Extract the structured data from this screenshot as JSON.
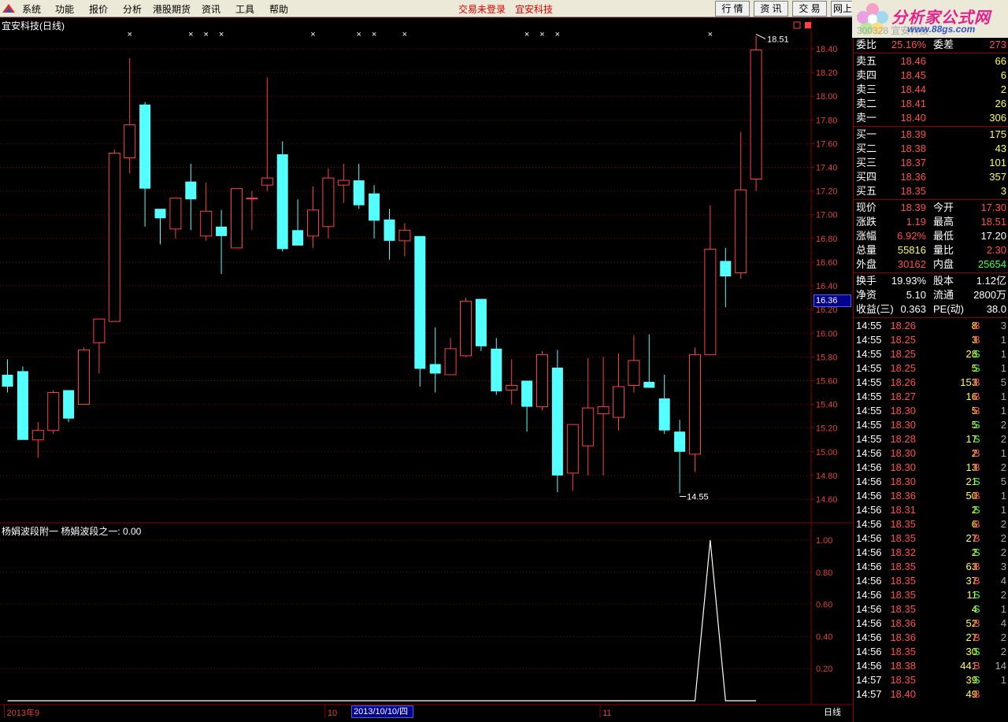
{
  "menu": {
    "items": [
      "系统",
      "功能",
      "报价",
      "分析",
      "港股期货",
      "资讯",
      "工具",
      "帮助"
    ],
    "notice_login": "交易未登录",
    "notice_stock": "宜安科技",
    "tabs": [
      "行 情",
      "资 讯",
      "交 易",
      "网上"
    ]
  },
  "brand": {
    "name": "分析家公式网",
    "url": "www.88gs.com",
    "behind_text": "300328 宜安科技"
  },
  "chart": {
    "title": "宜安科技(日线)",
    "price_ticks": [
      "18.40",
      "18.20",
      "18.00",
      "17.80",
      "17.60",
      "17.40",
      "17.20",
      "17.00",
      "16.80",
      "16.60",
      "16.40",
      "16.20",
      "16.00",
      "15.80",
      "15.60",
      "15.40",
      "15.20",
      "15.00",
      "14.80",
      "14.60"
    ],
    "high_label": "18.51",
    "low_label": "14.55",
    "current_price_tag": "16.36",
    "indicator_title": "杨娟波段附一  杨娟波段之一: 0.00",
    "indicator_ticks": [
      "1.00",
      "0.80",
      "0.60",
      "0.40",
      "0.20"
    ],
    "date_labels": [
      "2013年9",
      "10",
      "11"
    ],
    "date_highlight": "2013/10/10/四",
    "period": "日线"
  },
  "chart_data": {
    "type": "candlestick",
    "title": "宜安科技(日线)",
    "ylim": [
      14.55,
      18.51
    ],
    "candles": [
      {
        "o": 15.65,
        "h": 15.78,
        "l": 15.5,
        "c": 15.55
      },
      {
        "o": 15.68,
        "h": 15.72,
        "l": 15.15,
        "c": 15.1
      },
      {
        "o": 15.1,
        "h": 15.25,
        "l": 14.95,
        "c": 15.18
      },
      {
        "o": 15.18,
        "h": 15.52,
        "l": 15.15,
        "c": 15.5
      },
      {
        "o": 15.52,
        "h": 15.52,
        "l": 15.25,
        "c": 15.28
      },
      {
        "o": 15.4,
        "h": 15.88,
        "l": 15.4,
        "c": 15.86
      },
      {
        "o": 15.92,
        "h": 16.08,
        "l": 15.66,
        "c": 16.12
      },
      {
        "o": 16.1,
        "h": 17.55,
        "l": 16.1,
        "c": 17.52
      },
      {
        "o": 17.48,
        "h": 18.32,
        "l": 17.35,
        "c": 17.76
      },
      {
        "o": 17.93,
        "h": 17.95,
        "l": 16.9,
        "c": 17.22
      },
      {
        "o": 17.05,
        "h": 17.05,
        "l": 16.75,
        "c": 16.97
      },
      {
        "o": 16.88,
        "h": 17.14,
        "l": 16.8,
        "c": 17.14
      },
      {
        "o": 17.28,
        "h": 17.43,
        "l": 16.87,
        "c": 17.13
      },
      {
        "o": 16.82,
        "h": 17.27,
        "l": 16.78,
        "c": 17.03
      },
      {
        "o": 16.9,
        "h": 17.04,
        "l": 16.5,
        "c": 16.82
      },
      {
        "o": 16.72,
        "h": 17.22,
        "l": 16.72,
        "c": 17.22
      },
      {
        "o": 17.14,
        "h": 17.2,
        "l": 16.87,
        "c": 17.14
      },
      {
        "o": 17.25,
        "h": 18.16,
        "l": 17.2,
        "c": 17.31
      },
      {
        "o": 17.51,
        "h": 17.62,
        "l": 16.69,
        "c": 16.71
      },
      {
        "o": 16.87,
        "h": 17.13,
        "l": 16.74,
        "c": 16.74
      },
      {
        "o": 16.82,
        "h": 17.24,
        "l": 16.72,
        "c": 17.04
      },
      {
        "o": 16.9,
        "h": 17.39,
        "l": 16.8,
        "c": 17.31
      },
      {
        "o": 17.25,
        "h": 17.43,
        "l": 17.1,
        "c": 17.29
      },
      {
        "o": 17.29,
        "h": 17.43,
        "l": 17.05,
        "c": 17.08
      },
      {
        "o": 17.18,
        "h": 17.25,
        "l": 16.8,
        "c": 16.95
      },
      {
        "o": 16.96,
        "h": 17.05,
        "l": 16.62,
        "c": 16.78
      },
      {
        "o": 16.78,
        "h": 16.93,
        "l": 16.65,
        "c": 16.87
      },
      {
        "o": 16.82,
        "h": 16.82,
        "l": 15.55,
        "c": 15.7
      },
      {
        "o": 15.74,
        "h": 16.05,
        "l": 15.5,
        "c": 15.66
      },
      {
        "o": 15.65,
        "h": 15.96,
        "l": 15.65,
        "c": 15.87
      },
      {
        "o": 15.81,
        "h": 16.3,
        "l": 15.8,
        "c": 16.27
      },
      {
        "o": 16.29,
        "h": 16.29,
        "l": 15.85,
        "c": 15.89
      },
      {
        "o": 15.87,
        "h": 15.96,
        "l": 15.48,
        "c": 15.51
      },
      {
        "o": 15.52,
        "h": 15.78,
        "l": 15.4,
        "c": 15.56
      },
      {
        "o": 15.6,
        "h": 15.6,
        "l": 15.17,
        "c": 15.38
      },
      {
        "o": 15.38,
        "h": 15.85,
        "l": 15.35,
        "c": 15.82
      },
      {
        "o": 15.71,
        "h": 15.86,
        "l": 14.66,
        "c": 14.8
      },
      {
        "o": 14.82,
        "h": 15.22,
        "l": 14.67,
        "c": 15.23
      },
      {
        "o": 15.05,
        "h": 15.79,
        "l": 14.8,
        "c": 15.37
      },
      {
        "o": 15.32,
        "h": 15.8,
        "l": 14.8,
        "c": 15.38
      },
      {
        "o": 15.29,
        "h": 15.83,
        "l": 15.18,
        "c": 15.55
      },
      {
        "o": 15.56,
        "h": 15.98,
        "l": 15.5,
        "c": 15.77
      },
      {
        "o": 15.59,
        "h": 15.99,
        "l": 15.56,
        "c": 15.54
      },
      {
        "o": 15.45,
        "h": 15.65,
        "l": 15.15,
        "c": 15.18
      },
      {
        "o": 15.17,
        "h": 15.27,
        "l": 14.65,
        "c": 15.0
      },
      {
        "o": 14.98,
        "h": 15.88,
        "l": 14.83,
        "c": 15.82
      },
      {
        "o": 15.82,
        "h": 17.08,
        "l": 15.82,
        "c": 16.71
      },
      {
        "o": 16.61,
        "h": 16.72,
        "l": 16.22,
        "c": 16.48
      },
      {
        "o": 16.51,
        "h": 17.7,
        "l": 16.46,
        "c": 17.21
      },
      {
        "o": 17.3,
        "h": 18.51,
        "l": 17.2,
        "c": 18.39
      }
    ],
    "marker_days": [
      8,
      12,
      13,
      14,
      20,
      23,
      24,
      26,
      34,
      35,
      36,
      46
    ],
    "indicator": {
      "name": "杨娟波段之一",
      "ylim": [
        0,
        1
      ],
      "values": [
        0,
        0,
        0,
        0,
        0,
        0,
        0,
        0,
        0,
        0,
        0,
        0,
        0,
        0,
        0,
        0,
        0,
        0,
        0,
        0,
        0,
        0,
        0,
        0,
        0,
        0,
        0,
        0,
        0,
        0,
        0,
        0,
        0,
        0,
        0,
        0,
        0,
        0,
        0,
        0,
        0,
        0,
        0,
        0,
        0,
        0,
        1,
        0,
        0,
        0
      ]
    }
  },
  "quote": {
    "rows_top": [
      {
        "l": "委比",
        "v": "25.16%",
        "vc": "red",
        "l2": "委差",
        "v2": "273",
        "v2c": "red"
      }
    ],
    "asks": [
      {
        "l": "卖五",
        "p": "18.46",
        "v": "66"
      },
      {
        "l": "卖四",
        "p": "18.45",
        "v": "6"
      },
      {
        "l": "卖三",
        "p": "18.44",
        "v": "2"
      },
      {
        "l": "卖二",
        "p": "18.41",
        "v": "26"
      },
      {
        "l": "卖一",
        "p": "18.40",
        "v": "306"
      }
    ],
    "bids": [
      {
        "l": "买一",
        "p": "18.39",
        "v": "175"
      },
      {
        "l": "买二",
        "p": "18.38",
        "v": "43"
      },
      {
        "l": "买三",
        "p": "18.37",
        "v": "101"
      },
      {
        "l": "买四",
        "p": "18.36",
        "v": "357"
      },
      {
        "l": "买五",
        "p": "18.35",
        "v": "3"
      }
    ],
    "stats": [
      {
        "l": "现价",
        "v": "18.39",
        "vc": "red",
        "l2": "今开",
        "v2": "17.30",
        "v2c": "red"
      },
      {
        "l": "涨跌",
        "v": "1.19",
        "vc": "red",
        "l2": "最高",
        "v2": "18.51",
        "v2c": "red"
      },
      {
        "l": "涨幅",
        "v": "6.92%",
        "vc": "red",
        "l2": "最低",
        "v2": "17.20",
        "v2c": "white"
      },
      {
        "l": "总量",
        "v": "55816",
        "vc": "yellow",
        "l2": "量比",
        "v2": "2.30",
        "v2c": "red"
      },
      {
        "l": "外盘",
        "v": "30162",
        "vc": "red",
        "l2": "内盘",
        "v2": "25654",
        "v2c": "green"
      }
    ],
    "fundamentals": [
      {
        "l": "换手",
        "v": "19.93%",
        "l2": "股本",
        "v2": "1.12亿"
      },
      {
        "l": "净资",
        "v": "5.10",
        "l2": "流通",
        "v2": "2800万"
      },
      {
        "l": "收益(三)",
        "v": "0.363",
        "l2": "PE(动)",
        "v2": "38.0"
      }
    ],
    "ticks": [
      {
        "t": "14:55",
        "p": "18.26",
        "v": "8",
        "bs": "B",
        "n": "3"
      },
      {
        "t": "14:55",
        "p": "18.25",
        "v": "3",
        "bs": "B",
        "n": "1"
      },
      {
        "t": "14:55",
        "p": "18.25",
        "v": "28",
        "bs": "S",
        "n": "1"
      },
      {
        "t": "14:55",
        "p": "18.25",
        "v": "5",
        "bs": "S",
        "n": "1"
      },
      {
        "t": "14:55",
        "p": "18.26",
        "v": "153",
        "bs": "B",
        "n": "5"
      },
      {
        "t": "14:55",
        "p": "18.27",
        "v": "16",
        "bs": "B",
        "n": "1"
      },
      {
        "t": "14:55",
        "p": "18.30",
        "v": "5",
        "bs": "B",
        "n": "1"
      },
      {
        "t": "14:55",
        "p": "18.30",
        "v": "5",
        "bs": "S",
        "n": "2"
      },
      {
        "t": "14:55",
        "p": "18.28",
        "v": "17",
        "bs": "S",
        "n": "2"
      },
      {
        "t": "14:56",
        "p": "18.30",
        "v": "2",
        "bs": "B",
        "n": "1"
      },
      {
        "t": "14:56",
        "p": "18.30",
        "v": "13",
        "bs": "B",
        "n": "2"
      },
      {
        "t": "14:56",
        "p": "18.30",
        "v": "21",
        "bs": "S",
        "n": "5"
      },
      {
        "t": "14:56",
        "p": "18.36",
        "v": "50",
        "bs": "B",
        "n": "1"
      },
      {
        "t": "14:56",
        "p": "18.31",
        "v": "2",
        "bs": "S",
        "n": "1"
      },
      {
        "t": "14:56",
        "p": "18.35",
        "v": "6",
        "bs": "B",
        "n": "2"
      },
      {
        "t": "14:56",
        "p": "18.35",
        "v": "27",
        "bs": "B",
        "n": "2"
      },
      {
        "t": "14:56",
        "p": "18.32",
        "v": "2",
        "bs": "S",
        "n": "2"
      },
      {
        "t": "14:56",
        "p": "18.35",
        "v": "63",
        "bs": "B",
        "n": "3"
      },
      {
        "t": "14:56",
        "p": "18.35",
        "v": "37",
        "bs": "B",
        "n": "4"
      },
      {
        "t": "14:56",
        "p": "18.35",
        "v": "11",
        "bs": "S",
        "n": "2"
      },
      {
        "t": "14:56",
        "p": "18.35",
        "v": "4",
        "bs": "S",
        "n": "1"
      },
      {
        "t": "14:56",
        "p": "18.36",
        "v": "52",
        "bs": "B",
        "n": "4"
      },
      {
        "t": "14:56",
        "p": "18.36",
        "v": "27",
        "bs": "B",
        "n": "2"
      },
      {
        "t": "14:56",
        "p": "18.35",
        "v": "30",
        "bs": "S",
        "n": "2"
      },
      {
        "t": "14:56",
        "p": "18.38",
        "v": "441",
        "bs": "B",
        "n": "14"
      },
      {
        "t": "14:57",
        "p": "18.35",
        "v": "39",
        "bs": "S",
        "n": "1"
      },
      {
        "t": "14:57",
        "p": "18.40",
        "v": "49",
        "bs": "B",
        "n": ""
      }
    ]
  },
  "colors": {
    "up": "#FF4040",
    "down": "#54FFFF",
    "grid": "#8B0000",
    "bg": "#000000"
  }
}
